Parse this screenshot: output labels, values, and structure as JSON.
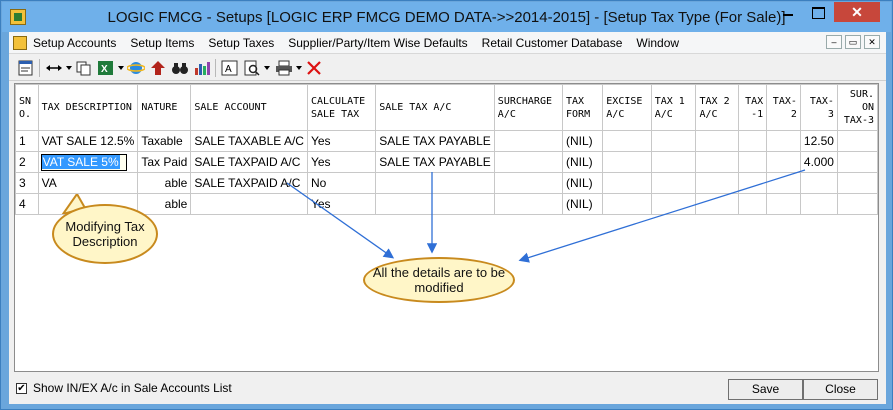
{
  "window": {
    "title": "LOGIC FMCG - Setups  [LOGIC ERP FMCG DEMO DATA->>2014-2015] - [Setup Tax Type (For Sale)]",
    "close_glyph": "✕"
  },
  "menu": {
    "items": [
      "Setup Accounts",
      "Setup Items",
      "Setup Taxes",
      "Supplier/Party/Item Wise Defaults",
      "Retail Customer Database",
      "Window"
    ],
    "mdi_buttons": [
      "–",
      "▭",
      "✕"
    ]
  },
  "toolbar": {
    "icons": [
      "form-icon",
      "expand-columns-icon",
      "copy-icon",
      "excel-icon",
      "internet-explorer-icon",
      "up-arrow-icon",
      "binoculars-icon",
      "chart-icon",
      "text-icon",
      "print-preview-icon",
      "printer-icon",
      "delete-icon"
    ]
  },
  "grid": {
    "headers": [
      "SN O.",
      "TAX DESCRIPTION",
      "NATURE",
      "SALE ACCOUNT",
      "CALCULATE SALE TAX",
      "SALE TAX A/C",
      "SURCHARGE A/C",
      "TAX FORM",
      "EXCISE A/C",
      "TAX 1 A/C",
      "TAX 2 A/C",
      "TAX -1",
      "TAX-2",
      "TAX-3",
      "SUR. ON TAX-3"
    ],
    "rows": [
      [
        "1",
        "VAT SALE 12.5%",
        "Taxable",
        "SALE TAXABLE A/C",
        "Yes",
        "SALE TAX PAYABLE",
        "",
        "(NIL)",
        "",
        "",
        "",
        "",
        "",
        "12.50",
        ""
      ],
      [
        "2",
        "VAT SALE 5%",
        "Tax Paid",
        "SALE TAXPAID A/C",
        "Yes",
        "SALE TAX PAYABLE",
        "",
        "(NIL)",
        "",
        "",
        "",
        "",
        "",
        "4.000",
        ""
      ],
      [
        "3",
        "VAT",
        "Taxable",
        "SALE TAXPAID A/C",
        "No",
        "",
        "",
        "(NIL)",
        "",
        "",
        "",
        "",
        "",
        "",
        ""
      ],
      [
        "4",
        "",
        "Taxable",
        "",
        "Yes",
        "",
        "",
        "(NIL)",
        "",
        "",
        "",
        "",
        "",
        "",
        ""
      ]
    ],
    "visible_row_text": {
      "r3_tax_desc": "VA",
      "r3_nature": "able",
      "r4_nature": "able"
    }
  },
  "callouts": {
    "modify_desc": "Modifying Tax Description",
    "all_details": "All the details are to be modified"
  },
  "footer": {
    "checkbox_label": "Show IN/EX A/c in Sale Accounts List",
    "checkbox_checked": "✔",
    "save_label": "Save",
    "close_label": "Close"
  },
  "colors": {
    "title_bg": "#6fb0ea",
    "close_bg": "#c7473b",
    "selection": "#3399ff",
    "callout_fill": "#fff6c8",
    "callout_border": "#c88a1e",
    "arrow": "#2f6fd6"
  }
}
